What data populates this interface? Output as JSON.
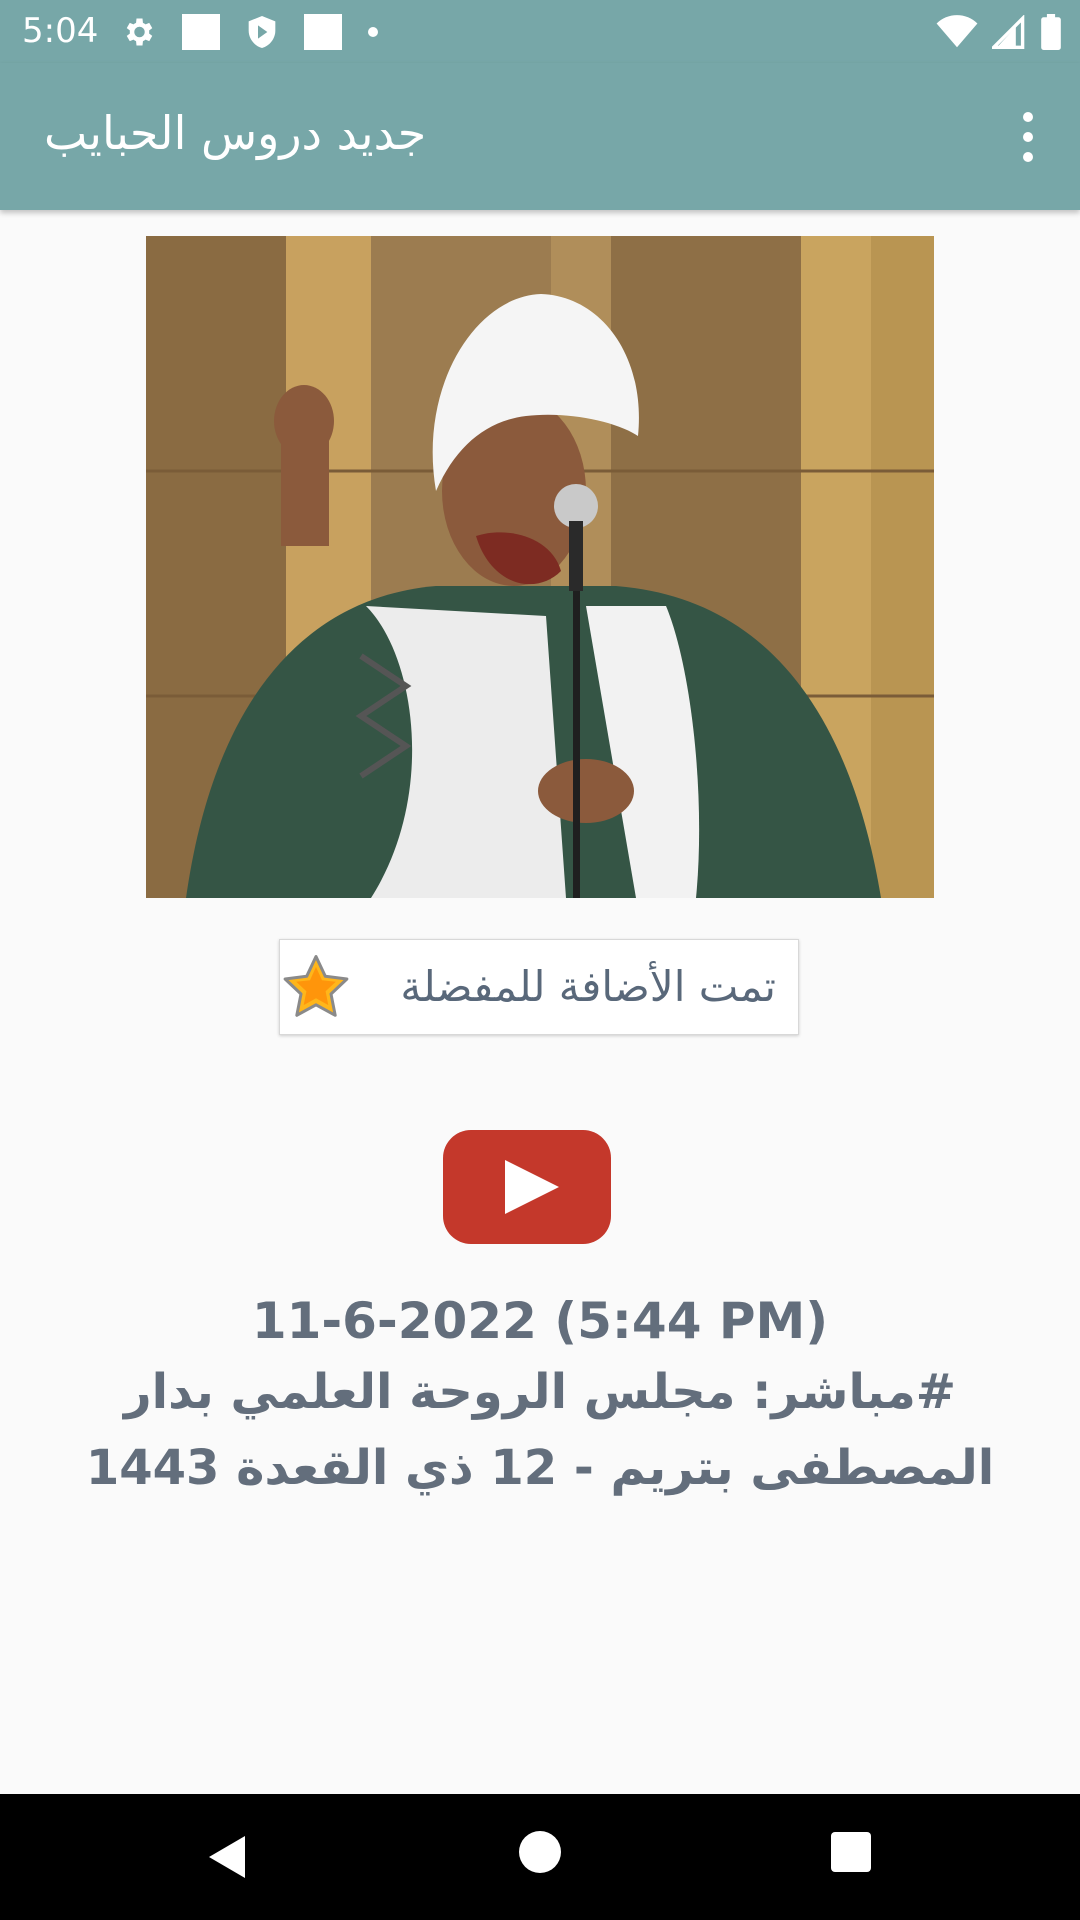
{
  "status_bar": {
    "time": "5:04",
    "left_icons": [
      "settings-icon",
      "notification-square-icon",
      "shield-icon",
      "notification-square-icon",
      "dot-icon"
    ],
    "right_icons": [
      "wifi-icon",
      "cell-signal-icon",
      "battery-icon"
    ]
  },
  "app_bar": {
    "title": "جديد دروس الحبايب",
    "menu_icon": "more-vert-icon",
    "color": "#77a7a8"
  },
  "favorite": {
    "label": "تمت الأضافة للمفضلة",
    "icon": "star-icon"
  },
  "play": {
    "icon": "youtube-play-icon",
    "color": "#c4382b"
  },
  "lesson": {
    "date": "11-6-2022 (5:44 PM)",
    "title": "#مباشر: مجلس الروحة العلمي بدار المصطفى بتريم - 12 ذي القعدة 1443"
  },
  "nav_bar": {
    "icons": [
      "back-icon",
      "home-icon",
      "recents-icon"
    ]
  }
}
